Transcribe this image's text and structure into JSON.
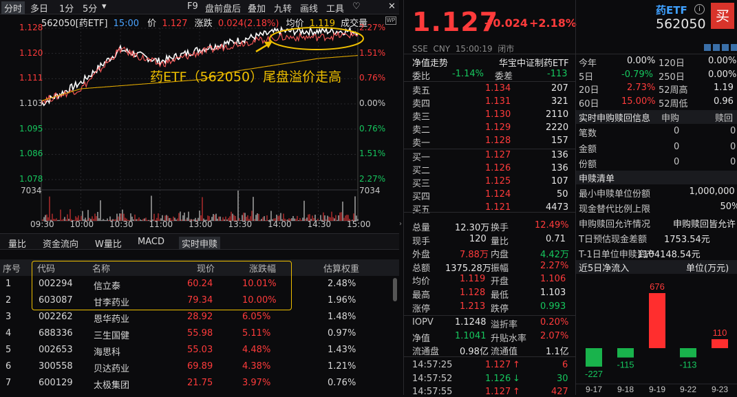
{
  "toolbar": {
    "tabs": [
      "分时",
      "多日",
      "1分",
      "5分"
    ],
    "tab_dropdown": "▾",
    "right": [
      "F9",
      "盘前盘后",
      "叠加",
      "九转",
      "画线",
      "工具"
    ],
    "heart": "♡",
    "close": "✕"
  },
  "chart": {
    "code_label": "562050[药ETF]",
    "time": "15:00",
    "price_label": "价",
    "price": "1.127",
    "chg_label": "涨跌",
    "chg": "0.024(2.18%)",
    "avg_label": "均价",
    "avg": "1.119",
    "vol_label": "成交量",
    "y_left": [
      "1.128",
      "1.120",
      "1.111",
      "1.103",
      "1.095",
      "1.086",
      "1.078"
    ],
    "y_right": [
      "2.27%",
      "1.51%",
      "0.76%",
      "0.00%",
      "0.76%",
      "1.51%",
      "2.27%"
    ],
    "vol_label_value": "7034",
    "x_labels": [
      "09:30",
      "10:00",
      "10:30",
      "11:00",
      "13:00",
      "13:30",
      "14:00",
      "14:30",
      "15:00"
    ],
    "annotation": "药ETF（562050）尾盘溢价走高",
    "wp_badge": "WP"
  },
  "chart_data": {
    "type": "line",
    "x": [
      "09:30",
      "10:00",
      "10:30",
      "11:00",
      "11:30/13:00",
      "13:30",
      "14:00",
      "14:30",
      "15:00"
    ],
    "series": [
      {
        "values": [
          1.103,
          1.11,
          1.121,
          1.117,
          1.121,
          1.124,
          1.127,
          1.127,
          1.127
        ]
      },
      {
        "values": [
          1.104,
          1.108,
          1.121,
          1.116,
          1.12,
          1.123,
          1.125,
          1.125,
          1.126
        ]
      },
      {
        "values": [
          1.104,
          1.108,
          1.109,
          1.11,
          1.111,
          1.114,
          1.116,
          1.118,
          1.119
        ]
      }
    ],
    "ylim": [
      1.078,
      1.128
    ]
  },
  "subtabs": [
    "量比",
    "资金流向",
    "W量比",
    "MACD",
    "实时申赎"
  ],
  "table": {
    "headers": [
      "序号",
      "代码",
      "名称",
      "现价",
      "涨跌幅",
      "估算权重"
    ],
    "rows": [
      [
        "1",
        "002294",
        "信立泰",
        "60.24",
        "10.01%",
        "2.48%"
      ],
      [
        "2",
        "603087",
        "甘李药业",
        "79.34",
        "10.00%",
        "1.96%"
      ],
      [
        "3",
        "002262",
        "恩华药业",
        "28.92",
        "6.05%",
        "1.48%"
      ],
      [
        "4",
        "688336",
        "三生国健",
        "55.98",
        "5.11%",
        "0.97%"
      ],
      [
        "5",
        "002653",
        "海思科",
        "55.03",
        "4.48%",
        "1.43%"
      ],
      [
        "6",
        "300558",
        "贝达药业",
        "69.89",
        "4.38%",
        "1.21%"
      ],
      [
        "7",
        "600129",
        "太极集团",
        "21.75",
        "3.97%",
        "0.76%"
      ]
    ]
  },
  "quote": {
    "price": "1.127",
    "chg": "+0.024",
    "pct": "+2.18%",
    "meta": "SSE  CNY  15:00:19  闭市",
    "trend_label": "净值走势",
    "index_name": "华宝中证制药ETF",
    "weibi_label": "委比",
    "weibi": "-1.14%",
    "weicha_label": "委差",
    "weicha": "-113",
    "asks": [
      [
        "卖五",
        "1.134",
        "207"
      ],
      [
        "卖四",
        "1.131",
        "321"
      ],
      [
        "卖三",
        "1.130",
        "2110"
      ],
      [
        "卖二",
        "1.129",
        "2220"
      ],
      [
        "卖一",
        "1.128",
        "157"
      ]
    ],
    "bids": [
      [
        "买一",
        "1.127",
        "136"
      ],
      [
        "买二",
        "1.126",
        "136"
      ],
      [
        "买三",
        "1.125",
        "107"
      ],
      [
        "买四",
        "1.124",
        "50"
      ],
      [
        "买五",
        "1.121",
        "4473"
      ]
    ],
    "stats": [
      [
        "总量",
        "12.30万",
        "换手",
        "12.49%"
      ],
      [
        "现手",
        "120",
        "量比",
        "0.71"
      ],
      [
        "外盘",
        "7.88万",
        "内盘",
        "4.42万"
      ],
      [
        "总额",
        "1375.28万",
        "振幅",
        "2.27%"
      ],
      [
        "均价",
        "1.119",
        "开盘",
        "1.106"
      ],
      [
        "最高",
        "1.128",
        "最低",
        "1.103"
      ],
      [
        "涨停",
        "1.213",
        "跌停",
        "0.993"
      ]
    ],
    "iopv": [
      [
        "IOPV",
        "1.1248",
        "溢折率",
        "0.20%"
      ],
      [
        "净值",
        "1.1041",
        "升贴水率",
        "2.07%"
      ],
      [
        "流通盘",
        "0.98亿",
        "流通值",
        "1.1亿"
      ]
    ],
    "ticks": [
      [
        "14:57:25",
        "1.127",
        "↑",
        "6"
      ],
      [
        "14:57:52",
        "1.126",
        "↓",
        "30"
      ],
      [
        "14:57:55",
        "1.127",
        "↑",
        "427"
      ]
    ]
  },
  "right": {
    "name": "药ETF",
    "code": "562050",
    "buy": "买",
    "info_icon": "i",
    "perf": [
      [
        "今年",
        "0.00%",
        "120日",
        "0.00%"
      ],
      [
        "5日",
        "-0.79%",
        "250日",
        "0.00%"
      ],
      [
        "20日",
        "2.73%",
        "52周高",
        "1.19"
      ],
      [
        "60日",
        "15.00%",
        "52周低",
        "0.96"
      ]
    ],
    "rt_title": "实时申购赎回信息",
    "rt_sub": "申购",
    "rt_red": "赎回",
    "rt_rows": [
      [
        "笔数",
        "0",
        "0"
      ],
      [
        "金额",
        "0",
        "0"
      ],
      [
        "份额",
        "0",
        "0"
      ]
    ],
    "list_title": "申赎清单",
    "list": [
      [
        "最小申赎单位份额",
        "1,000,000"
      ],
      [
        "现金替代比例上限",
        "50%"
      ],
      [
        "申购赎回允许情况",
        "申购赎回皆允许"
      ],
      [
        "T日预估现金差额",
        "1753.54元"
      ],
      [
        "T-1日单位申赎资产",
        "1104148.54元"
      ]
    ],
    "flow_title": "近5日净流入",
    "flow_unit": "单位(万元)",
    "flow_chart": {
      "type": "bar",
      "categories": [
        "9-17",
        "9-18",
        "9-19",
        "9-22",
        "9-23"
      ],
      "values": [
        -227,
        -115,
        676,
        -113,
        110
      ]
    }
  }
}
